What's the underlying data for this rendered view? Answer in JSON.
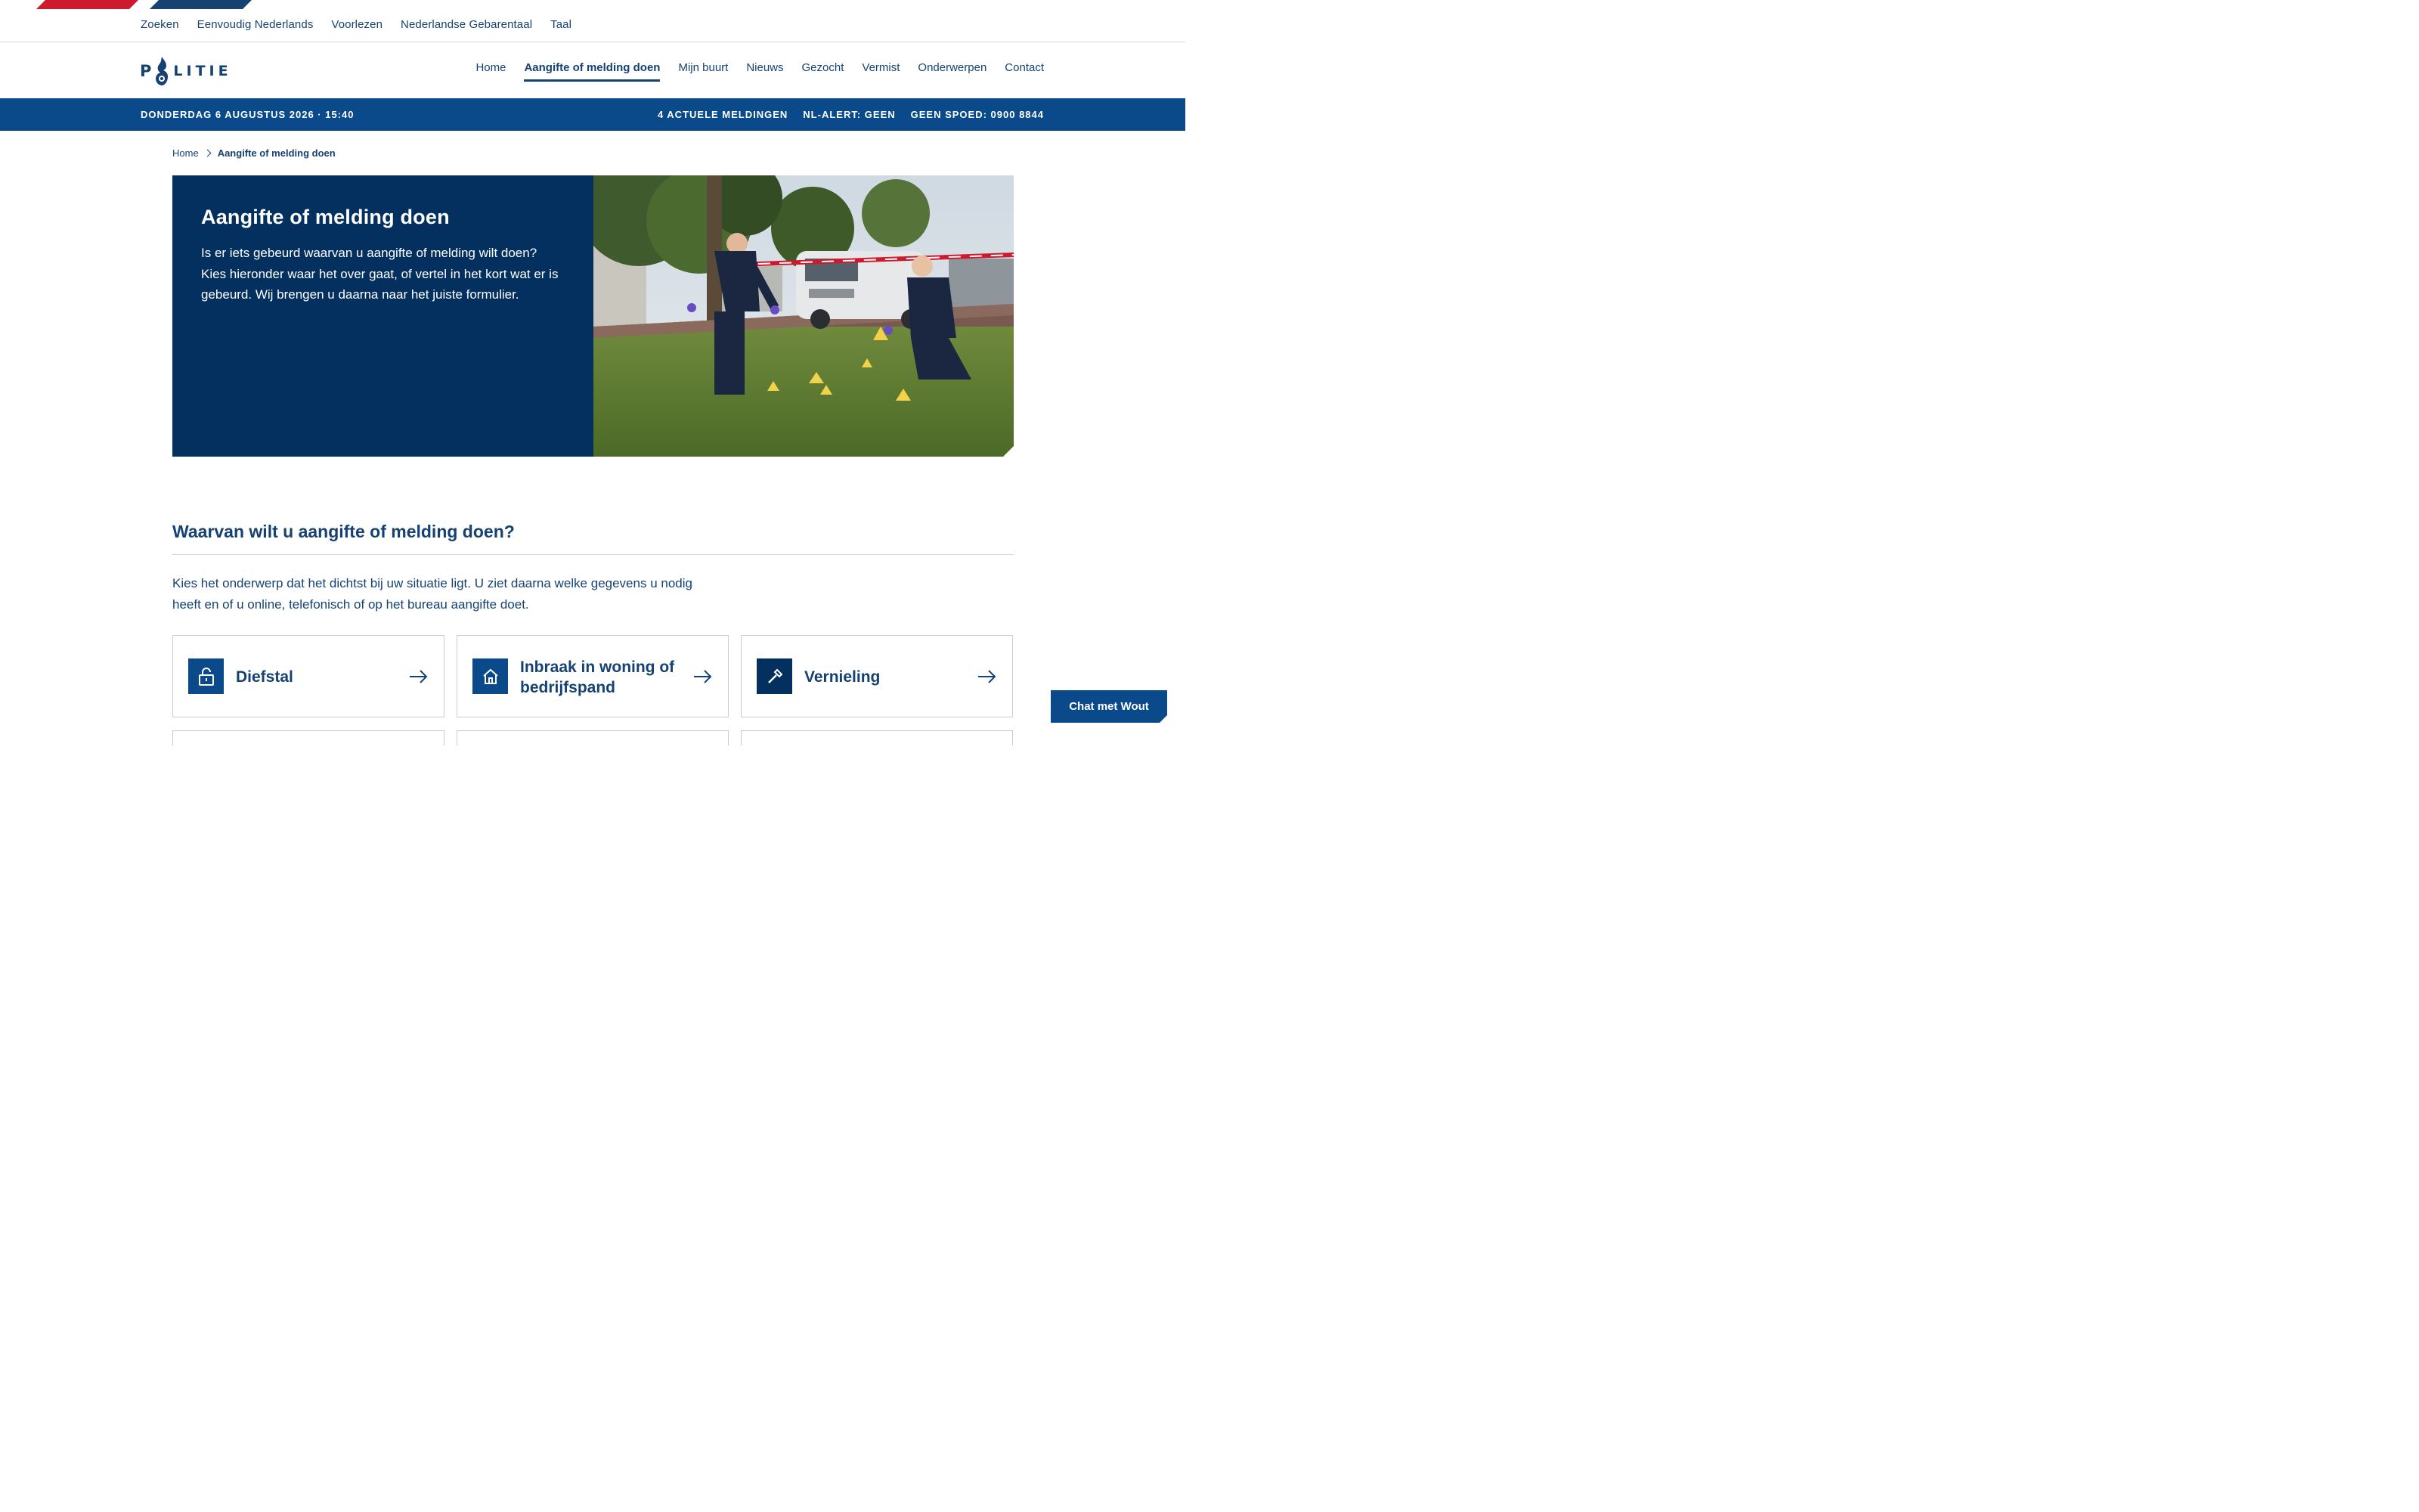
{
  "utility_nav": [
    "Zoeken",
    "Eenvoudig Nederlands",
    "Voorlezen",
    "Nederlandse Gebarentaal",
    "Taal"
  ],
  "logo": {
    "p": "P",
    "rest": "LITIE",
    "icon": "police-flame-icon"
  },
  "main_nav": [
    {
      "label": "Home",
      "active": false
    },
    {
      "label": "Aangifte of melding doen",
      "active": true
    },
    {
      "label": "Mijn buurt",
      "active": false
    },
    {
      "label": "Nieuws",
      "active": false
    },
    {
      "label": "Gezocht",
      "active": false
    },
    {
      "label": "Vermist",
      "active": false
    },
    {
      "label": "Onderwerpen",
      "active": false
    },
    {
      "label": "Contact",
      "active": false
    }
  ],
  "statusbar": {
    "date": "DONDERDAG 6 AUGUSTUS 2026 · 15:40",
    "meldingen": "4 ACTUELE MELDINGEN",
    "nlalert": "NL-ALERT: GEEN",
    "spoed": "GEEN SPOED: 0900 8844"
  },
  "breadcrumb": {
    "home": "Home",
    "current": "Aangifte of melding doen"
  },
  "hero": {
    "title": "Aangifte of melding doen",
    "text": "Is er iets gebeurd waarvan u aangifte of melding wilt doen? Kies hieronder waar het over gaat, of vertel in het kort wat er is gebeurd. Wij brengen u daarna naar het juiste formulier."
  },
  "section": {
    "title": "Waarvan wilt u aangifte of melding doen?",
    "intro": "Kies het onderwerp dat het dichtst bij uw situatie ligt. U ziet daarna welke gegevens u nodig heeft en of u online, telefonisch of op het bureau aangifte doet."
  },
  "cards": [
    {
      "label": "Diefstal",
      "icon": "unlock-icon"
    },
    {
      "label": "Inbraak in woning of bedrijfspand",
      "icon": "house-icon"
    },
    {
      "label": "Vernieling",
      "icon": "hammer-icon"
    }
  ],
  "chat": {
    "label": "Chat met Wout"
  },
  "colors": {
    "brand_blue": "#154273",
    "status_blue": "#0a4a8a",
    "hero_blue": "#03305f",
    "brand_red": "#ce1a2e"
  }
}
